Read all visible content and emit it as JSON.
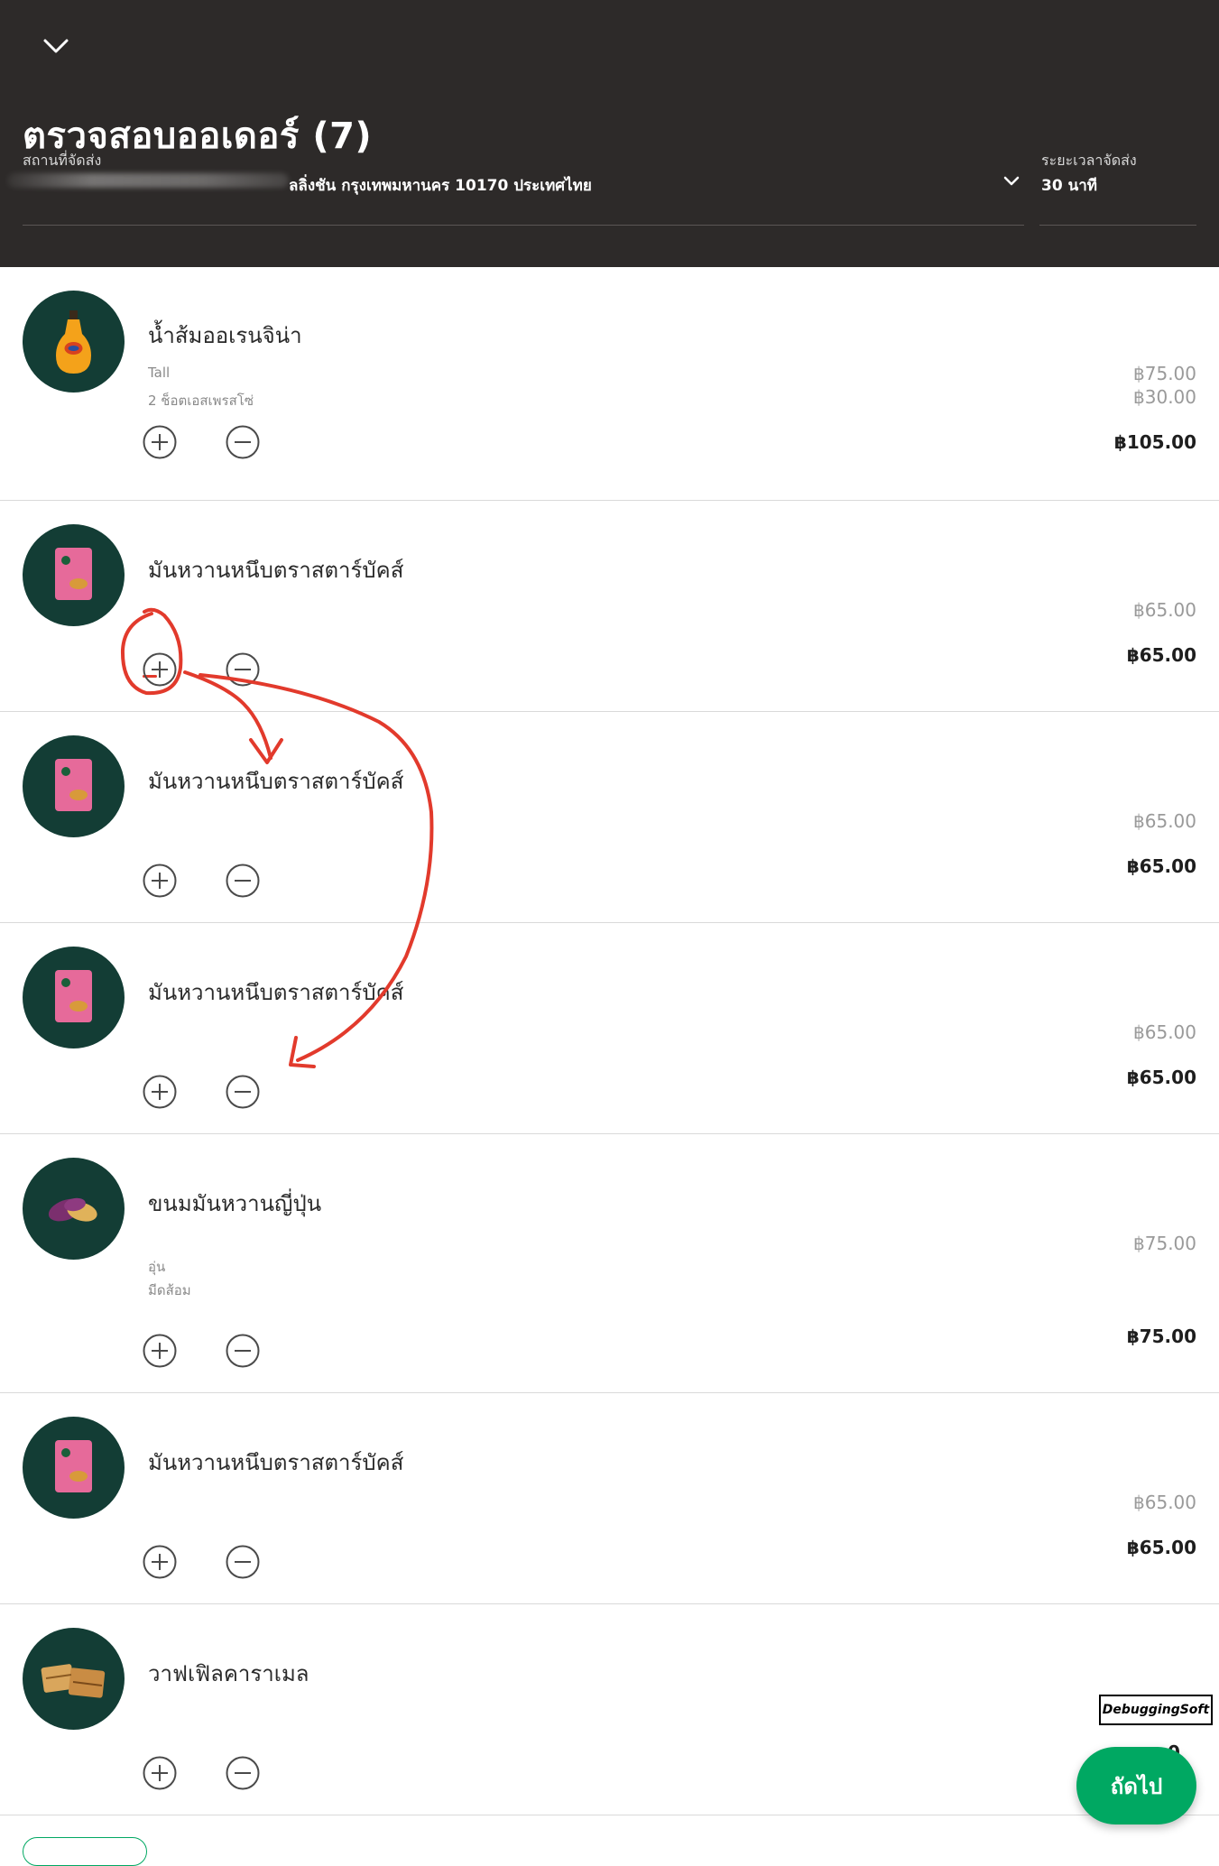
{
  "header": {
    "title": "ตรวจสอบออเดอร์ (7)",
    "address_label": "สถานที่จัดส่ง",
    "address_value": "ลลิ่งชัน กรุงเทพมหานคร 10170 ประเทศไทย",
    "delivery_time_label": "ระยะเวลาจัดส่ง",
    "delivery_time_value": "30 นาที"
  },
  "items": [
    {
      "name": "น้ำส้มออเรนจิน่า",
      "options": [
        "Tall",
        "2 ช็อตเอสเพรสโซ่"
      ],
      "prices": [
        "฿75.00",
        "฿30.00"
      ],
      "total": "฿105.00",
      "image": "orange-juice-bottle"
    },
    {
      "name": "มันหวานหนึบตราสตาร์บัคส์",
      "options": [],
      "prices": [
        "฿65.00"
      ],
      "total": "฿65.00",
      "image": "sweet-potato-snack-bag"
    },
    {
      "name": "มันหวานหนึบตราสตาร์บัคส์",
      "options": [],
      "prices": [
        "฿65.00"
      ],
      "total": "฿65.00",
      "image": "sweet-potato-snack-bag"
    },
    {
      "name": "มันหวานหนึบตราสตาร์บัคส์",
      "options": [],
      "prices": [
        "฿65.00"
      ],
      "total": "฿65.00",
      "image": "sweet-potato-snack-bag"
    },
    {
      "name": "ขนมมันหวานญี่ปุ่น",
      "options": [
        "อุ่น",
        "มีดส้อม"
      ],
      "prices": [
        "฿75.00"
      ],
      "total": "฿75.00",
      "image": "japanese-sweet-potato"
    },
    {
      "name": "มันหวานหนึบตราสตาร์บัคส์",
      "options": [],
      "prices": [
        "฿65.00"
      ],
      "total": "฿65.00",
      "image": "sweet-potato-snack-bag"
    },
    {
      "name": "วาฟเฟิลคาราเมล",
      "options": [],
      "prices": [],
      "total": "0",
      "image": "caramel-waffle"
    }
  ],
  "next_button": "ถัดไป",
  "watermark": "DebuggingSoft",
  "colors": {
    "header_bg": "#2d2a29",
    "thumb_bg": "#133d35",
    "accent_green": "#00a862",
    "annotation_red": "#e23a2c"
  }
}
